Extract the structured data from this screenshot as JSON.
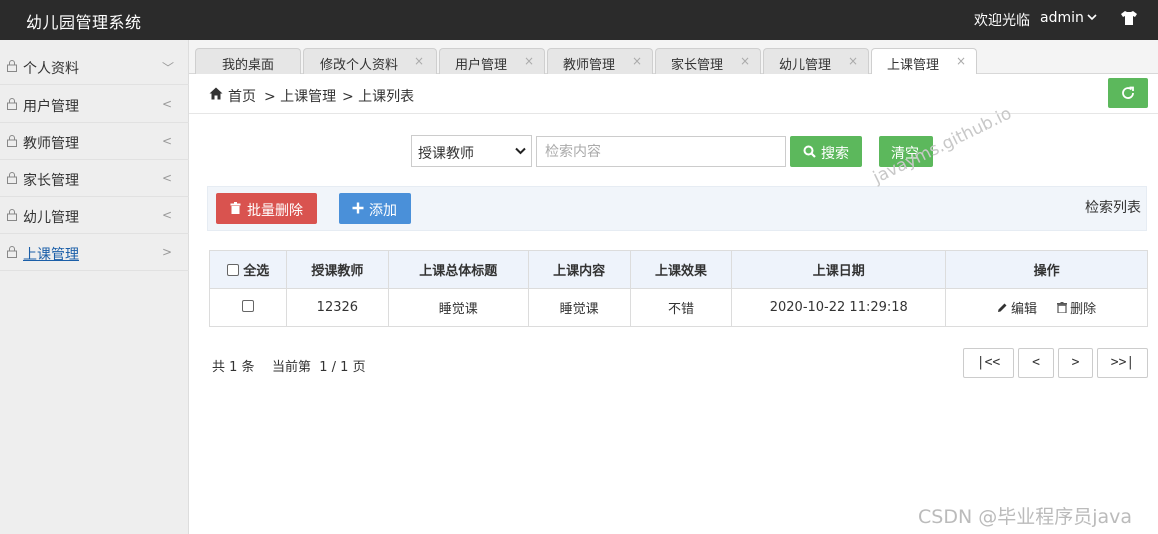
{
  "header": {
    "app_title": "幼儿园管理系统",
    "welcome": "欢迎光临",
    "user": "admin"
  },
  "sidebar": {
    "items": [
      {
        "label": "个人资料",
        "arrow": "﹀"
      },
      {
        "label": "用户管理",
        "arrow": "<"
      },
      {
        "label": "教师管理",
        "arrow": "<"
      },
      {
        "label": "家长管理",
        "arrow": "<"
      },
      {
        "label": "幼儿管理",
        "arrow": "<"
      },
      {
        "label": "上课管理",
        "arrow": ">"
      }
    ]
  },
  "tabs": [
    {
      "label": "我的桌面"
    },
    {
      "label": "修改个人资料"
    },
    {
      "label": "用户管理"
    },
    {
      "label": "教师管理"
    },
    {
      "label": "家长管理"
    },
    {
      "label": "幼儿管理"
    },
    {
      "label": "上课管理"
    }
  ],
  "tab_close": "×",
  "breadcrumb": {
    "home": "首页",
    "level1": "> 上课管理",
    "level2": "> 上课列表"
  },
  "search": {
    "field_selected": "授课教师",
    "placeholder": "检索内容",
    "search_label": "搜索",
    "clear_label": "清空"
  },
  "toolbar": {
    "batch_delete_label": "批量删除",
    "add_label": "添加",
    "list_title": "检索列表"
  },
  "table": {
    "select_all_label": "全选",
    "columns": [
      "授课教师",
      "上课总体标题",
      "上课内容",
      "上课效果",
      "上课日期",
      "操作"
    ],
    "rows": [
      {
        "teacher": "12326",
        "title": "睡觉课",
        "content": "睡觉课",
        "effect": "不错",
        "date": "2020-10-22 11:29:18"
      }
    ],
    "edit_label": "编辑",
    "delete_label": "删除"
  },
  "pagination": {
    "total": "共 1 条",
    "current": "当前第  1 / 1 页",
    "first": "|<<",
    "prev": "<",
    "next": ">",
    "last": ">>|"
  },
  "watermark": "CSDN @毕业程序员java",
  "watermark_site": "javayms.github.io",
  "colors": {
    "topbar": "#2b2b2b",
    "green": "#5cb85c",
    "red": "#d9534f",
    "blue": "#4a90d9",
    "link": "#1a5ea8"
  }
}
